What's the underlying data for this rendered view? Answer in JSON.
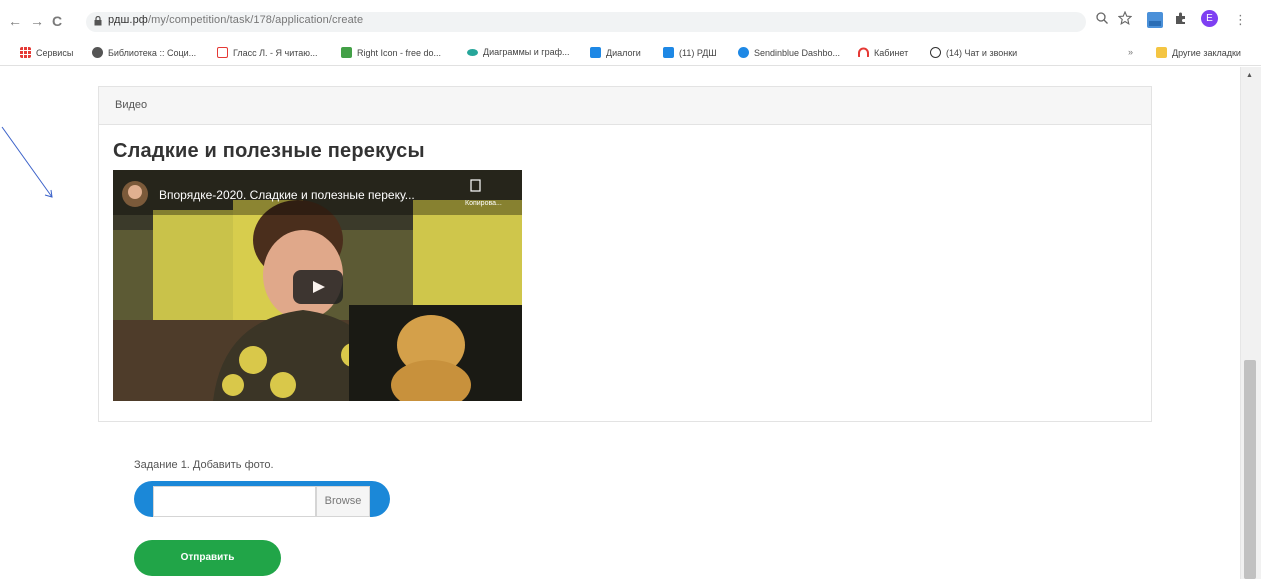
{
  "browser": {
    "url_host": "рдш.рф",
    "url_path": "/my/competition/task/178/application/create",
    "nav": {
      "back": "←",
      "forward": "→",
      "reload": "C"
    }
  },
  "bookmarks": [
    {
      "label": "Сервисы",
      "color": "#e53935"
    },
    {
      "label": "Библиотека :: Соци...",
      "color": "#555555"
    },
    {
      "label": "Гласс Л. - Я читаю...",
      "color": "#e53935"
    },
    {
      "label": "Right Icon - free do...",
      "color": "#43a047"
    },
    {
      "label": "Диаграммы и граф...",
      "color": "#26a69a"
    },
    {
      "label": "Диалоги",
      "color": "#1e88e5"
    },
    {
      "label": "(11) РДШ",
      "color": "#1e88e5"
    },
    {
      "label": "Sendinblue Dashbo...",
      "color": "#1e88e5"
    },
    {
      "label": "Кабинет",
      "color": "#e53935"
    },
    {
      "label": "(14) Чат и звонки",
      "color": "#333333"
    }
  ],
  "bookmarks_overflow": "»",
  "other_bookmarks": "Другие закладки",
  "panel": {
    "header": "Видео",
    "title": "Сладкие и полезные перекусы",
    "video_title": "Впорядке-2020. Сладкие и полезные переку...",
    "video_copy": "Копирова..."
  },
  "task": {
    "label": "Задание 1. Добавить фото.",
    "browse_label": "Browse",
    "submit_label": "Отправить"
  },
  "profile_initial": "E",
  "colors": {
    "accent_blue": "#1b88d8",
    "submit_green": "#21a548",
    "profile_purple": "#7e3ff2"
  }
}
